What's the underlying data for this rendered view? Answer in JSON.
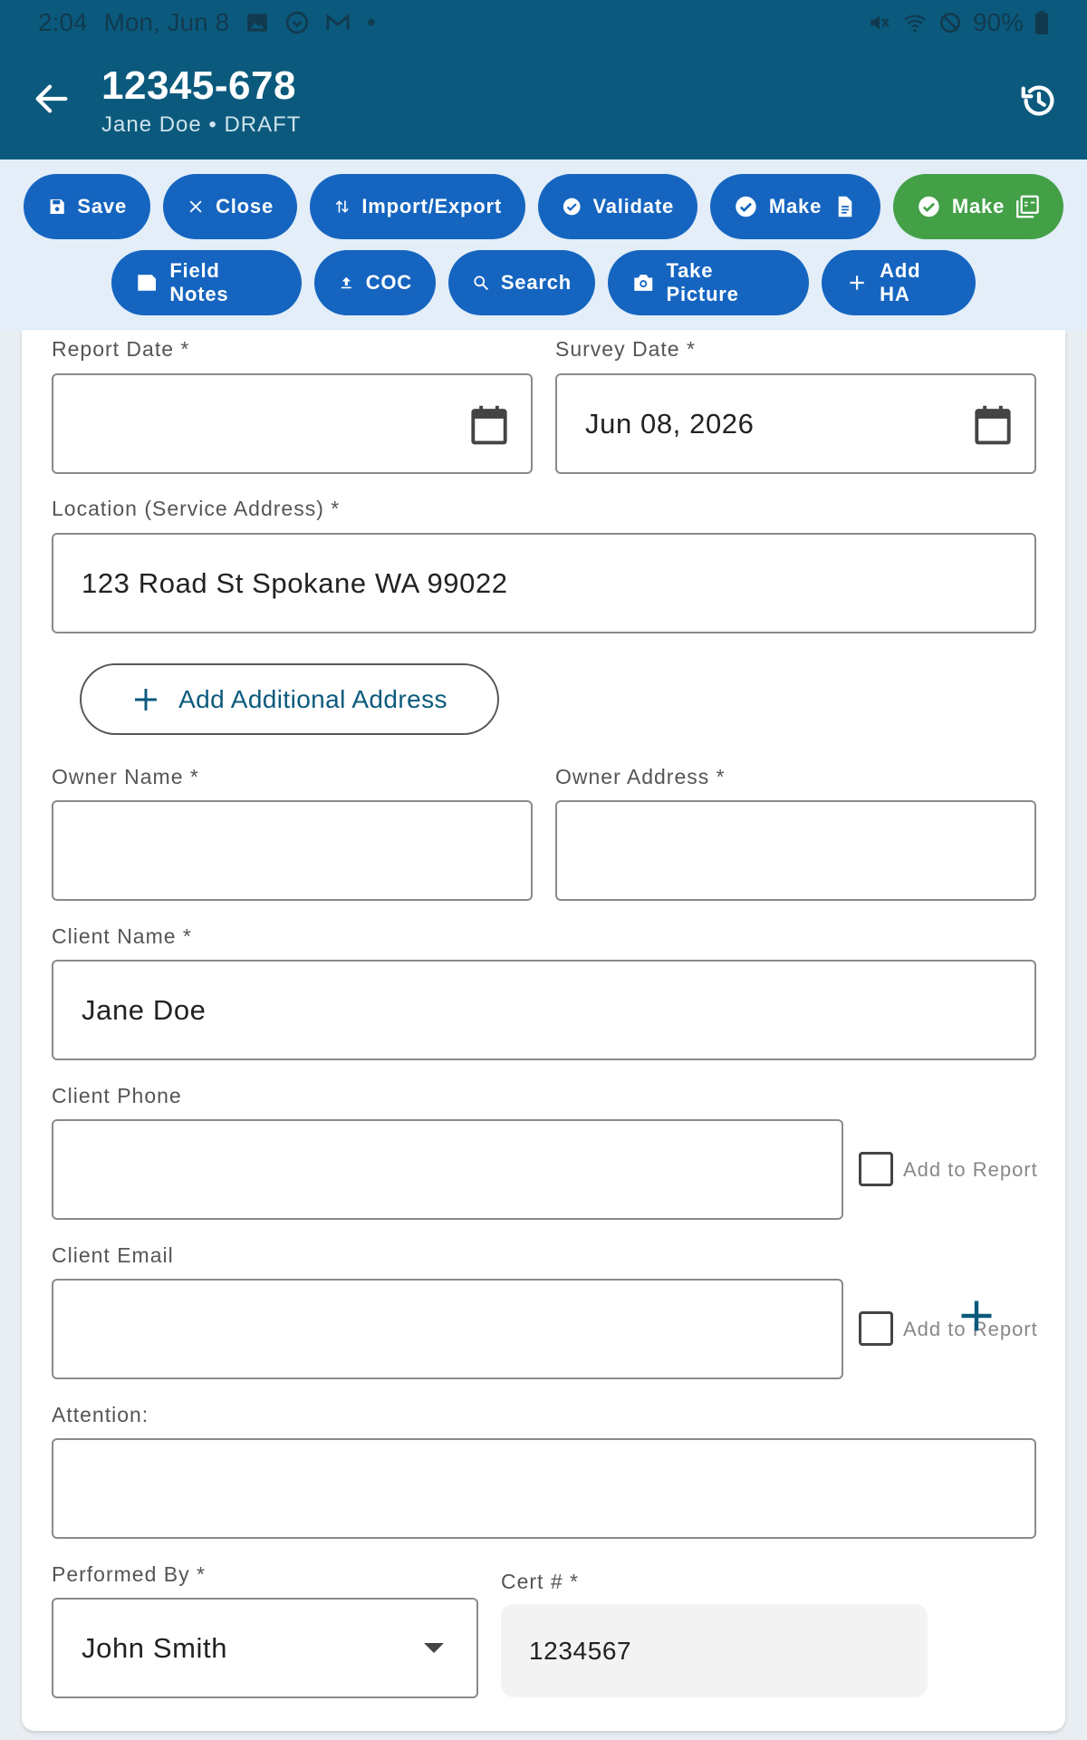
{
  "status": {
    "time": "2:04",
    "date": "Mon, Jun 8",
    "dot": "•",
    "battery": "90%"
  },
  "appbar": {
    "title": "12345-678",
    "subtitle": "Jane Doe • DRAFT"
  },
  "toolbar": {
    "row1": [
      {
        "label": "Save",
        "icon": "save-icon"
      },
      {
        "label": "Close",
        "icon": "close-icon"
      },
      {
        "label": "Import/Export",
        "icon": "import-export-icon"
      },
      {
        "label": "Validate",
        "icon": "check-circle-icon"
      },
      {
        "label": "Make",
        "icon": "check-circle-icon",
        "trail_icon": "document-icon"
      },
      {
        "label": "Make",
        "icon": "check-circle-icon",
        "trail_icon": "pdf-icon",
        "color": "#43a047"
      }
    ],
    "row2": [
      {
        "label": "Field Notes",
        "icon": "folder-icon"
      },
      {
        "label": "COC",
        "icon": "upload-icon"
      },
      {
        "label": "Search",
        "icon": "search-icon"
      },
      {
        "label": "Take Picture",
        "icon": "camera-icon"
      },
      {
        "label": "Add HA",
        "icon": "plus-icon"
      }
    ]
  },
  "form": {
    "report_date": {
      "label": "Report Date *",
      "value": ""
    },
    "survey_date": {
      "label": "Survey Date *",
      "value": "Jun 08, 2026"
    },
    "location": {
      "label": "Location (Service Address) *",
      "value": "123 Road St Spokane WA 99022"
    },
    "add_address": "Add Additional Address",
    "owner_name": {
      "label": "Owner Name *",
      "value": ""
    },
    "owner_address": {
      "label": "Owner Address *",
      "value": ""
    },
    "client_name": {
      "label": "Client Name *",
      "value": "Jane Doe"
    },
    "client_phone": {
      "label": "Client Phone",
      "value": "",
      "checkbox": "Add to Report"
    },
    "client_email": {
      "label": "Client Email",
      "value": "",
      "checkbox": "Add to Report"
    },
    "attention": {
      "label": "Attention:",
      "value": ""
    },
    "performed_by": {
      "label": "Performed By *",
      "value": "John Smith"
    },
    "cert": {
      "label": "Cert # *",
      "value": "1234567"
    }
  },
  "colors": {
    "appbar": "#0b5a7d",
    "button": "#1565c0",
    "green": "#43a047",
    "toolbar_bg": "#e3eef9"
  }
}
